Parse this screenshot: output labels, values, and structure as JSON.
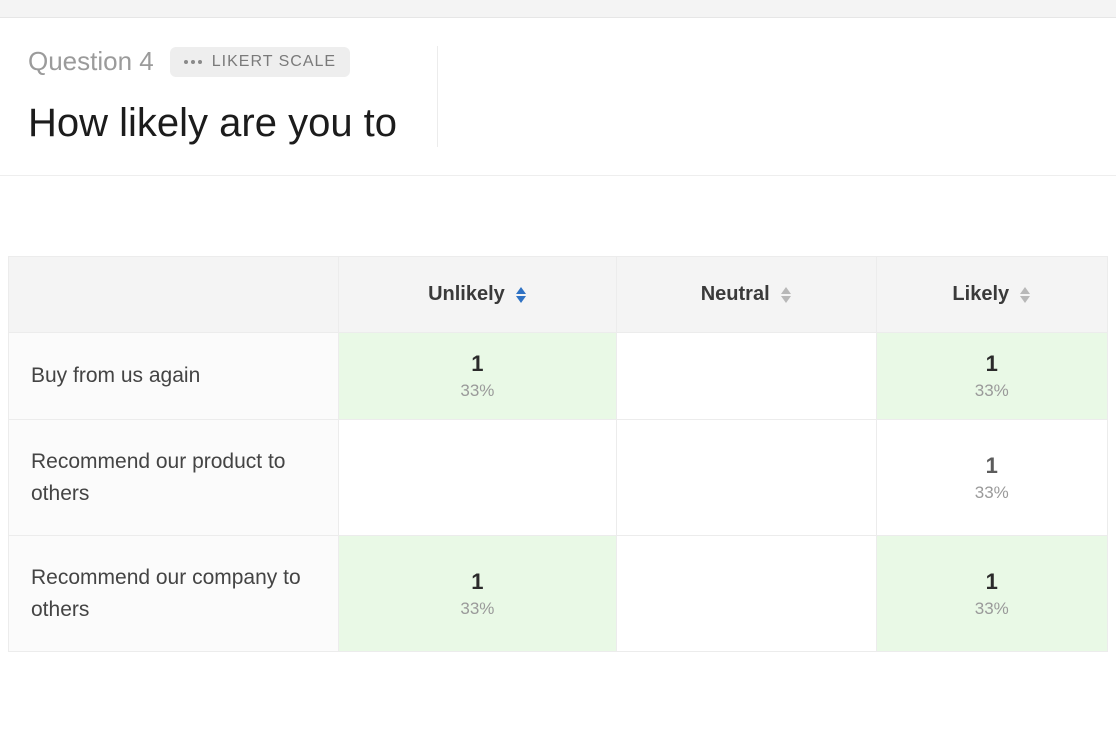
{
  "header": {
    "question_label": "Question 4",
    "type_label": "LIKERT SCALE",
    "question_text": "How likely are you to"
  },
  "table": {
    "columns": [
      "Unlikely",
      "Neutral",
      "Likely"
    ],
    "active_sort_col": 0,
    "rows": [
      {
        "label": "Buy from us again",
        "cells": [
          {
            "count": "1",
            "pct": "33%",
            "highlight": true
          },
          {
            "count": "",
            "pct": "",
            "highlight": false
          },
          {
            "count": "1",
            "pct": "33%",
            "highlight": true
          }
        ]
      },
      {
        "label": "Recommend our product to others",
        "cells": [
          {
            "count": "",
            "pct": "",
            "highlight": false
          },
          {
            "count": "",
            "pct": "",
            "highlight": false
          },
          {
            "count": "1",
            "pct": "33%",
            "highlight": false
          }
        ]
      },
      {
        "label": "Recommend our company to others",
        "cells": [
          {
            "count": "1",
            "pct": "33%",
            "highlight": true
          },
          {
            "count": "",
            "pct": "",
            "highlight": false
          },
          {
            "count": "1",
            "pct": "33%",
            "highlight": true
          }
        ]
      }
    ]
  }
}
